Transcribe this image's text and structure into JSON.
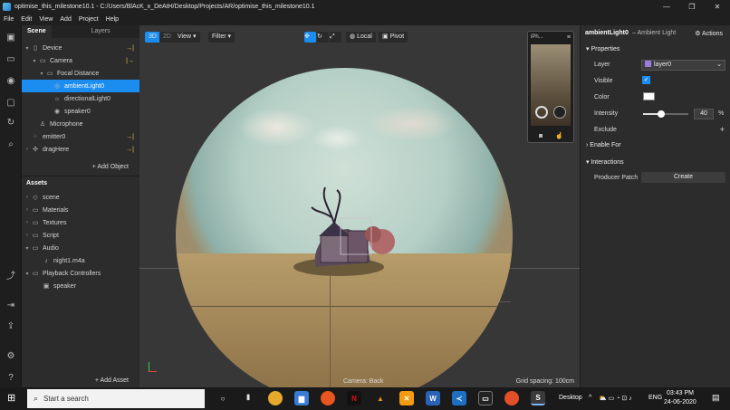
{
  "window": {
    "title": "optimise_this_milestone10.1 - C:/Users/BlAcK_x_DeAtH/Desktop/Projects/AR/optimise_this_milestone10.1",
    "minimize": "—",
    "maximize": "❐",
    "close": "✕"
  },
  "menu": [
    "File",
    "Edit",
    "View",
    "Add",
    "Project",
    "Help"
  ],
  "scene": {
    "tab_scene": "Scene",
    "tab_layers": "Layers",
    "items": [
      {
        "label": "Device",
        "arrow": "▾",
        "icon": "▯",
        "marker": "→|"
      },
      {
        "label": "Camera",
        "arrow": "▾",
        "icon": "▭",
        "marker": "|→"
      },
      {
        "label": "Focal Distance",
        "arrow": "▾",
        "icon": "▭",
        "marker": ""
      },
      {
        "label": "ambientLight0",
        "arrow": "",
        "icon": "◎",
        "marker": ""
      },
      {
        "label": "directionalLight0",
        "arrow": "",
        "icon": "☼",
        "marker": ""
      },
      {
        "label": "speaker0",
        "arrow": "",
        "icon": "◉",
        "marker": ""
      },
      {
        "label": "Microphone",
        "arrow": "",
        "icon": "♙",
        "marker": ""
      },
      {
        "label": "emitter0",
        "arrow": "",
        "icon": "⁘",
        "marker": "→|"
      },
      {
        "label": "dragHere",
        "arrow": "›",
        "icon": "✣",
        "marker": "→|"
      }
    ],
    "add_object": "+ Add Object"
  },
  "assets": {
    "title": "Assets",
    "items": [
      {
        "label": "scene",
        "arrow": "›",
        "icon": "◇"
      },
      {
        "label": "Materials",
        "arrow": "›",
        "icon": "▭"
      },
      {
        "label": "Textures",
        "arrow": "›",
        "icon": "▭"
      },
      {
        "label": "Script",
        "arrow": "›",
        "icon": "▭"
      },
      {
        "label": "Audio",
        "arrow": "▾",
        "icon": "▭"
      },
      {
        "label": "night1.m4a",
        "arrow": "",
        "icon": "♪"
      },
      {
        "label": "Playback Controllers",
        "arrow": "▾",
        "icon": "▭"
      },
      {
        "label": "speaker",
        "arrow": "",
        "icon": "▣"
      }
    ],
    "add_asset": "+ Add Asset"
  },
  "viewport": {
    "mode_3d": "3D",
    "mode_2d": "2D",
    "view_menu": "View ▾",
    "filter_menu": "Filter ▾",
    "local": "Local",
    "pivot": "Pivot",
    "device_label": "iPh...",
    "camera_status": "Camera: Back",
    "grid_status": "Grid spacing: 100cm"
  },
  "properties": {
    "object_name": "ambientLight0",
    "object_type": "– Ambient Light",
    "actions": "Actions",
    "section_properties": "Properties",
    "layer_label": "Layer",
    "layer_value": "layer0",
    "visible_label": "Visible",
    "color_label": "Color",
    "intensity_label": "Intensity",
    "intensity_value": "40",
    "intensity_unit": "%",
    "intensity_fraction": 0.4,
    "exclude_label": "Exclude",
    "section_enable_for": "Enable For",
    "section_interactions": "Interactions",
    "producer_patch_label": "Producer Patch",
    "create_button": "Create"
  },
  "taskbar": {
    "search_placeholder": "Start a search",
    "desktop_label": "Desktop",
    "language": "ENG",
    "time": "03:43 PM",
    "date": "24-06-2020"
  },
  "colors": {
    "selection": "#1b8cf0",
    "accent": "#1b8cf0"
  }
}
